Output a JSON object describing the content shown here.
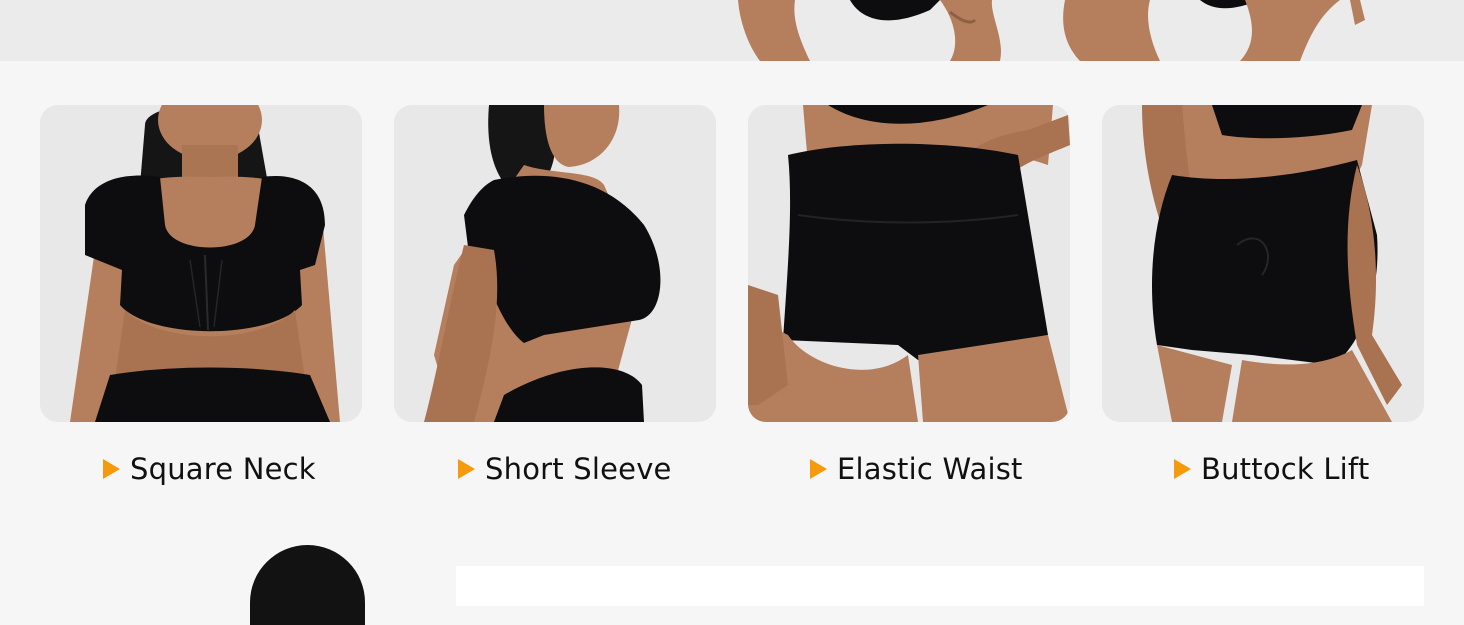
{
  "colors": {
    "accent_arrow": "#f59a0c",
    "garment": "#0d0d0f",
    "skin": "#b57f5d",
    "card_background": "#e9e8e8",
    "page_background": "#f7f6f6",
    "top_strip": "#ebebeb"
  },
  "features": [
    {
      "label": "Square Neck",
      "icon": "play-triangle-icon"
    },
    {
      "label": "Short Sleeve",
      "icon": "play-triangle-icon"
    },
    {
      "label": "Elastic Waist",
      "icon": "play-triangle-icon"
    },
    {
      "label": "Buttock Lift",
      "icon": "play-triangle-icon"
    }
  ]
}
